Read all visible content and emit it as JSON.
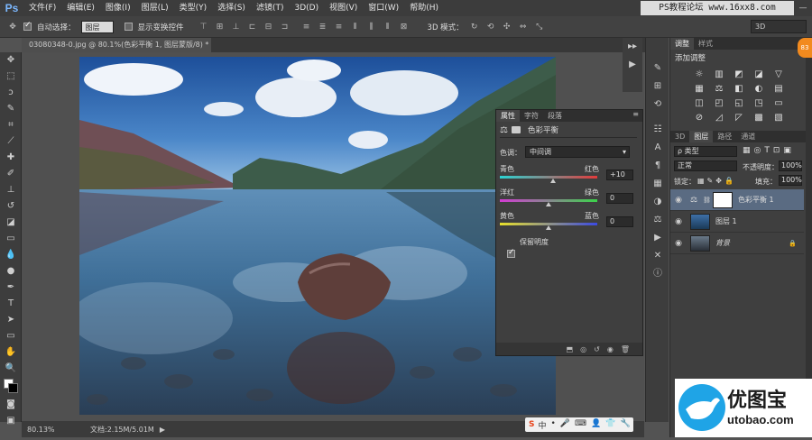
{
  "app": {
    "logo": "Ps",
    "window_control": "—"
  },
  "menu": [
    "文件(F)",
    "编辑(E)",
    "图像(I)",
    "图层(L)",
    "类型(Y)",
    "选择(S)",
    "滤镜(T)",
    "3D(D)",
    "视图(V)",
    "窗口(W)",
    "帮助(H)"
  ],
  "watermark_top": "PS教程论坛 www.16xx8.com",
  "options": {
    "auto_select_label": "自动选择：",
    "auto_select_value": "图层",
    "show_transform_label": "显示变换控件",
    "mode_3d_label": "3D 模式：",
    "workspace_value": "3D"
  },
  "document": {
    "tab_title": "03080348-0.jpg @ 80.1%(色彩平衡 1, 图层蒙版/8) *",
    "close": "×"
  },
  "status": {
    "zoom": "80.13%",
    "doc_info": "文档:2.15M/5.01M"
  },
  "ime": {
    "brand": "S",
    "items": [
      "中",
      "•",
      "🎤",
      "⌨",
      "👤",
      "👕",
      "🔧"
    ]
  },
  "properties": {
    "tabs": [
      "属性",
      "字符",
      "段落"
    ],
    "panel_title": "色彩平衡",
    "tone_label": "色调：",
    "tone_value": "中间调",
    "sliders": [
      {
        "left": "青色",
        "right": "红色",
        "value": "+10",
        "fraction": 0.55
      },
      {
        "left": "洋红",
        "right": "绿色",
        "value": "0",
        "fraction": 0.5
      },
      {
        "left": "黄色",
        "right": "蓝色",
        "value": "0",
        "fraction": 0.5
      }
    ],
    "preserve_label": "保留明度",
    "preserve_checked": true
  },
  "adjust": {
    "tabs": [
      "调整",
      "样式"
    ],
    "title": "添加调整",
    "icons": [
      "☼",
      "▥",
      "◩",
      "◪",
      "▽",
      "▦",
      "⚖",
      "◧",
      "◐",
      "▤",
      "◫",
      "◰",
      "◱",
      "◳",
      "▭",
      "⊘",
      "◿",
      "◸",
      "▩",
      "▧"
    ]
  },
  "layers": {
    "tabs": [
      "3D",
      "图层",
      "路径",
      "通道"
    ],
    "filter_value": "ρ 类型",
    "blend_mode": "正常",
    "opacity_label": "不透明度：",
    "opacity_value": "100%",
    "lock_label": "锁定：",
    "fill_label": "填充：",
    "fill_value": "100%",
    "items": [
      {
        "name": "色彩平衡 1",
        "kind": "adjust",
        "selected": true
      },
      {
        "name": "图层 1",
        "kind": "photo",
        "selected": false
      },
      {
        "name": "背景",
        "kind": "photo",
        "selected": false,
        "locked": true
      }
    ]
  },
  "badge": "83",
  "logo_bottom": {
    "cn": "优图宝",
    "url": "utobao.com"
  },
  "colors": {
    "accent": "#1fa4e6",
    "selected_layer": "#5a6b82"
  }
}
